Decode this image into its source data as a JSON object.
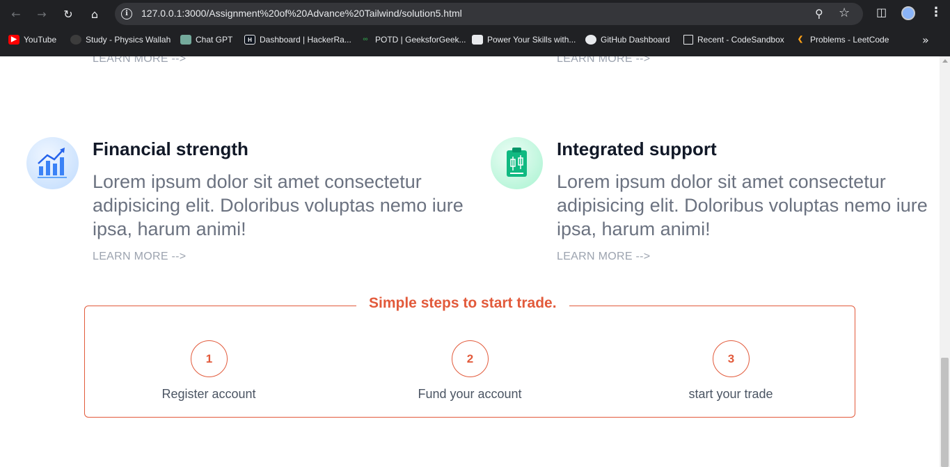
{
  "browser": {
    "url": "127.0.0.1:3000/Assignment%20of%20Advance%20Tailwind/solution5.html",
    "bookmarks": [
      {
        "label": "YouTube",
        "icon": "youtube-icon",
        "color": "#ff0000"
      },
      {
        "label": "Study - Physics Wallah",
        "icon": "pw-icon",
        "color": "#3c3c3c"
      },
      {
        "label": "Chat GPT",
        "icon": "chatgpt-icon",
        "color": "#74aa9c"
      },
      {
        "label": "Dashboard | HackerRa...",
        "icon": "hackerrank-icon",
        "color": "#1ba94c"
      },
      {
        "label": "POTD | GeeksforGeek...",
        "icon": "gfg-icon",
        "color": "#2f8d46"
      },
      {
        "label": "Power Your Skills with...",
        "icon": "codestudio-icon",
        "color": "#555555"
      },
      {
        "label": "GitHub Dashboard",
        "icon": "github-icon",
        "color": "#e8eaed"
      },
      {
        "label": "Recent - CodeSandbox",
        "icon": "codesandbox-icon",
        "color": "#e8eaed"
      },
      {
        "label": "Problems - LeetCode",
        "icon": "leetcode-icon",
        "color": "#ffa116"
      }
    ]
  },
  "features_top": {
    "learn_left": "LEARN MORE -->",
    "learn_right": "LEARN MORE -->"
  },
  "features": [
    {
      "title": "Financial strength",
      "text": "Lorem ipsum dolor sit amet consectetur adipisicing elit. Doloribus voluptas nemo iure ipsa, harum animi!",
      "learn": "LEARN MORE -->",
      "icon": "chart-growth-icon",
      "icon_bg": "#dbeafe"
    },
    {
      "title": "Integrated support",
      "text": "Lorem ipsum dolor sit amet consectetur adipisicing elit. Doloribus voluptas nemo iure ipsa, harum animi!",
      "learn": "LEARN MORE -->",
      "icon": "clipboard-candles-icon",
      "icon_bg": "#d1fae5"
    }
  ],
  "steps": {
    "title": "Simple steps to start trade.",
    "accent": "#e25a3b",
    "items": [
      {
        "number": "1",
        "label": "Register account"
      },
      {
        "number": "2",
        "label": "Fund your account"
      },
      {
        "number": "3",
        "label": "start your trade"
      }
    ]
  }
}
